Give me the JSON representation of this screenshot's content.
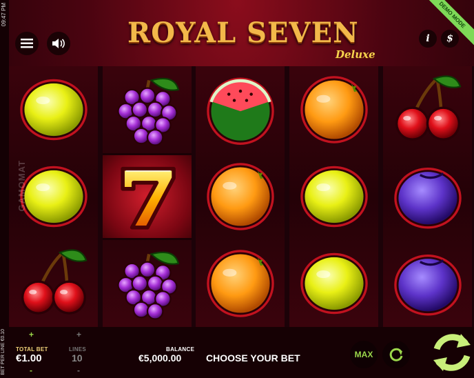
{
  "status": {
    "time": "09:47 PM",
    "bet_per_line": "BET PER LINE €0.10"
  },
  "header": {
    "title": "ROYAL SEVEN",
    "subtitle": "Deluxe",
    "demo_badge": "DEMO MODE",
    "menu_icon": "menu-icon",
    "sound_icon": "speaker-icon",
    "info_label": "i",
    "paytable_label": "$"
  },
  "watermark": "GAMOMAT",
  "reels": [
    [
      "lemon",
      "lemon",
      "cherries"
    ],
    [
      "grapes",
      "seven",
      "grapes"
    ],
    [
      "watermelon",
      "orange",
      "orange"
    ],
    [
      "orange",
      "lemon",
      "lemon"
    ],
    [
      "cherries",
      "plum",
      "plum"
    ]
  ],
  "bottom": {
    "total_bet_label": "TOTAL BET",
    "total_bet_value": "€1.00",
    "lines_label": "LINES",
    "lines_value": "10",
    "plus": "+",
    "minus": "-",
    "balance_label": "BALANCE",
    "balance_value": "€5,000.00",
    "message": "CHOOSE YOUR BET",
    "max_label": "MAX"
  },
  "colors": {
    "accent_green": "#9bd74b",
    "gold": "#f1d37a",
    "background": "#4a0410"
  }
}
